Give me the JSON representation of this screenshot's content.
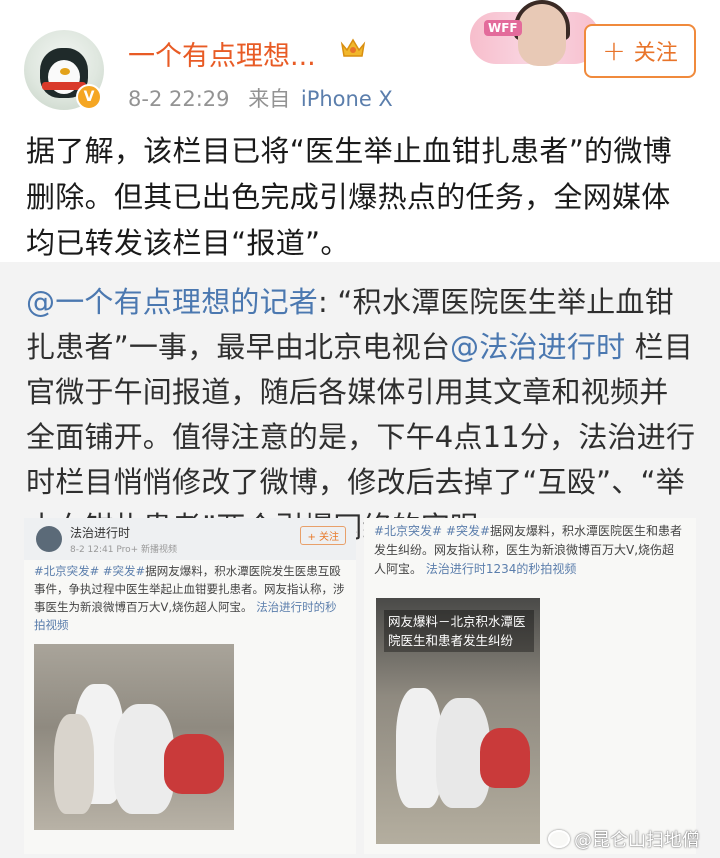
{
  "header": {
    "username": "一个有点理想...",
    "timestamp": "8-2 22:29",
    "source_prefix": "来自",
    "source": "iPhone X",
    "follow_label": "关注",
    "follow_icon": "plus-icon",
    "decor_label": "WFF"
  },
  "post": {
    "text": "据了解，该栏目已将“医生举止血钳扎患者”的微博删除。但其已出色完成引爆热点的任务，全网媒体均已转发该栏目“报道”。"
  },
  "repost": {
    "author_mention": "@一个有点理想的记者",
    "text_part1": ": “积水潭医院医生举止血钳扎患者”一事，最早由北京电视台",
    "mention2": "@法治进行时",
    "text_part2": " 栏目官微于午间报道，随后各媒体引用其文章和视频并全面铺开。值得注意的是，下午4点11分，法治进行时栏目悄悄修改了微博，修改后去掉了“互殴”、“举止血钳扎患者”两个引爆网络的字眼。",
    "image1": {
      "account": "法治进行时",
      "time": "8-2 12:41  Pro+ 新播视频",
      "follow": "+ 关注",
      "tags": "#北京突发# #突发#",
      "body": "据网友爆料，积水潭医院发生医患互殴事件，争执过程中医生举起止血钳要扎患者。网友指认称，涉事医生为新浪微博百万大V,烧伤超人阿宝。",
      "link": "法治进行时的秒拍视频"
    },
    "image2": {
      "tags": "#北京突发# #突发#",
      "body": "据网友爆料，积水潭医院医生和患者发生纠纷。网友指认称，医生为新浪微博百万大V,烧伤超人阿宝。",
      "link": "法治进行时1234的秒拍视频",
      "video_caption": "网友爆料－北京积水潭医院医生和患者发生纠纷"
    }
  },
  "watermark": "@昆仑山扫地僧",
  "colors": {
    "username": "#e85b25",
    "link": "#4b78b0",
    "follow_border": "#f08a3c",
    "repost_bg": "#f3f3f3"
  }
}
